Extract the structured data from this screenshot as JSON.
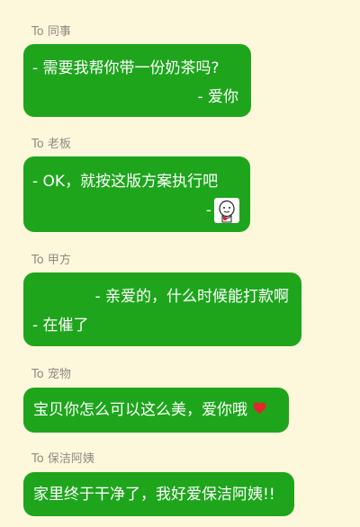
{
  "messages": [
    {
      "to_label": "To 同事",
      "lines": [
        "- 需要我帮你带一份奶茶吗?",
        "- 爱你"
      ]
    },
    {
      "to_label": "To 老板",
      "lines": [
        "- OK，就按这版方案执行吧",
        "-"
      ],
      "sticker_icon": "cartoon-face-sticker"
    },
    {
      "to_label": "To 甲方",
      "lines": [
        "- 亲爱的，什么时候能打款啊",
        "- 在催了"
      ]
    },
    {
      "to_label": "To 宠物",
      "lines": [
        "宝贝你怎么可以这么美，爱你哦"
      ],
      "emoji_icon": "red-heart-icon"
    },
    {
      "to_label": "To 保洁阿姨",
      "lines": [
        "家里终于干净了，我好爱保洁阿姨!!"
      ]
    }
  ],
  "colors": {
    "background": "#fdf8dc",
    "bubble": "#1ea51c",
    "bubble_text": "#ffffff",
    "label_text": "#8f8a80",
    "heart": "#e5252c"
  }
}
